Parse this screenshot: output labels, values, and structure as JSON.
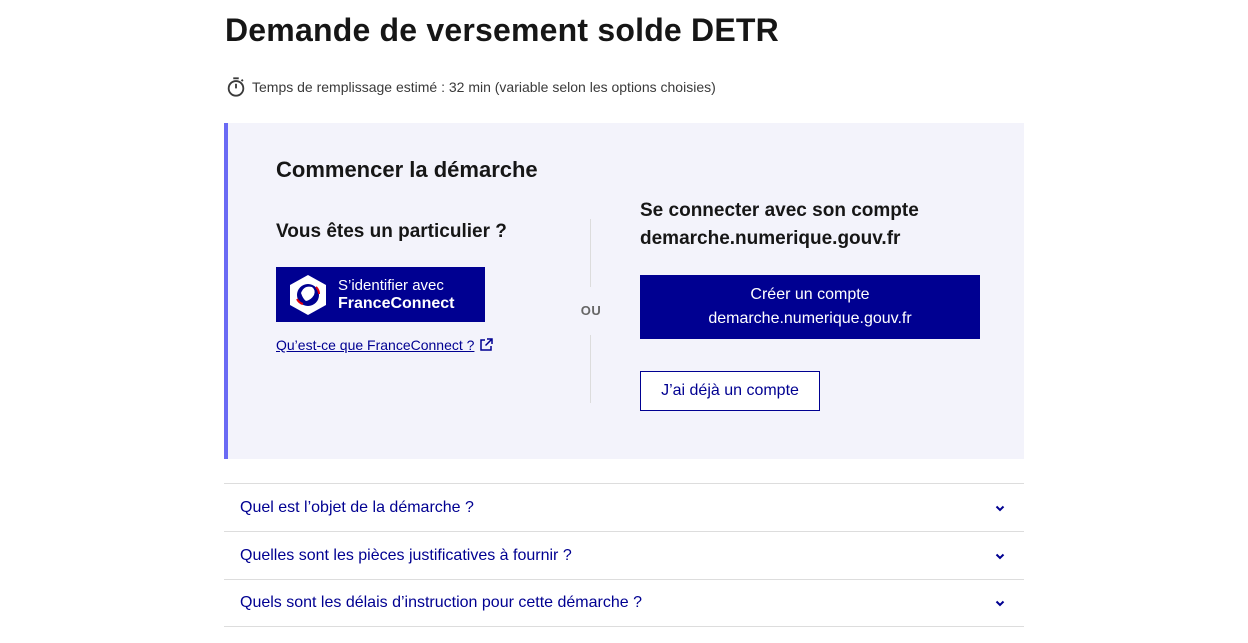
{
  "page": {
    "title": "Demande de versement solde DETR",
    "estimate": "Temps de remplissage estimé : 32 min (variable selon les options choisies)",
    "estimate_icon": "timer-icon"
  },
  "start": {
    "title": "Commencer la démarche",
    "particulier": {
      "title": "Vous êtes un particulier ?",
      "franceconnect_line1": "S’identifier avec",
      "franceconnect_line2": "FranceConnect",
      "franceconnect_link": "Qu’est-ce que FranceConnect ?"
    },
    "separator": "OU",
    "account": {
      "title_line1": "Se connecter avec son compte",
      "title_line2": "demarche.numerique.gouv.fr",
      "create_line1": "Créer un compte",
      "create_line2": "demarche.numerique.gouv.fr",
      "login": "J’ai déjà un compte"
    }
  },
  "accordion": [
    {
      "label": "Quel est l’objet de la démarche ?"
    },
    {
      "label": "Quelles sont les pièces justificatives à fournir ?"
    },
    {
      "label": "Quels sont les délais d’instruction pour cette démarche ?"
    }
  ],
  "colors": {
    "primary": "#000091",
    "accent_border": "#6a6af4",
    "panel_bg": "#f3f3fb"
  }
}
